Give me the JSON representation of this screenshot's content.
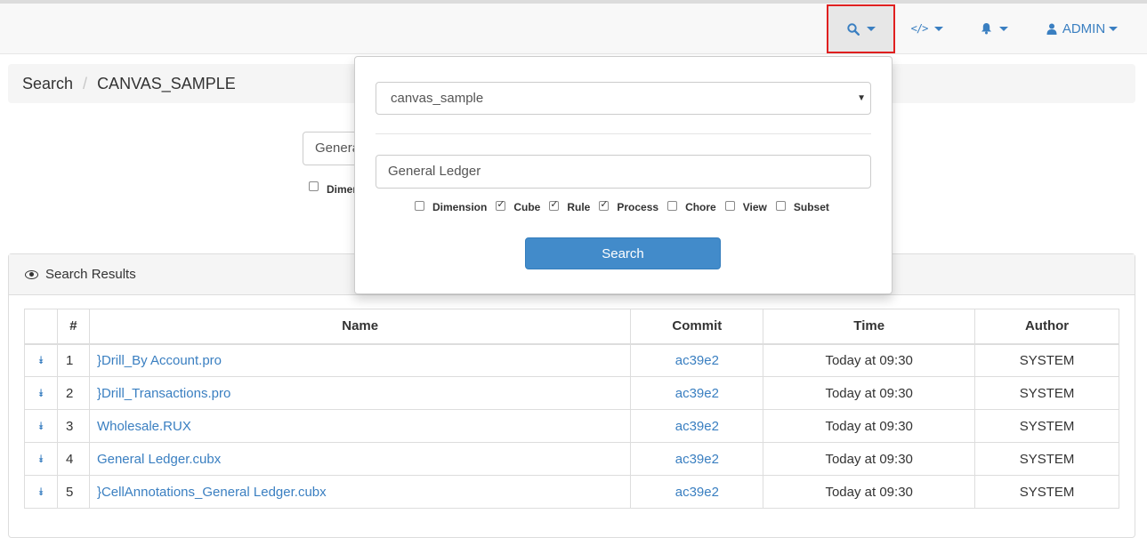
{
  "navbar": {
    "search_icon": "search-icon",
    "code_icon": "code-icon",
    "code_glyph": "</>",
    "bell_icon": "bell-icon",
    "user_icon": "user-icon",
    "admin_label": "ADMIN"
  },
  "breadcrumb": {
    "items": [
      "Search",
      "CANVAS_SAMPLE"
    ],
    "separator": "/"
  },
  "background_form": {
    "search_value_visible": "General Ledger",
    "checkbox_label_visible": "Dimension"
  },
  "dropdown": {
    "instance_select": "canvas_sample",
    "search_value": "General Ledger",
    "filters": [
      {
        "label": "Dimension",
        "checked": false
      },
      {
        "label": "Cube",
        "checked": true
      },
      {
        "label": "Rule",
        "checked": true
      },
      {
        "label": "Process",
        "checked": true
      },
      {
        "label": "Chore",
        "checked": false
      },
      {
        "label": "View",
        "checked": false
      },
      {
        "label": "Subset",
        "checked": false
      }
    ],
    "search_button": "Search"
  },
  "results": {
    "title": "Search Results",
    "columns": [
      "",
      "#",
      "Name",
      "Commit",
      "Time",
      "Author"
    ],
    "rows": [
      {
        "num": "1",
        "name": "}Drill_By Account.pro",
        "commit": "ac39e2",
        "time": "Today at 09:30",
        "author": "SYSTEM"
      },
      {
        "num": "2",
        "name": "}Drill_Transactions.pro",
        "commit": "ac39e2",
        "time": "Today at 09:30",
        "author": "SYSTEM"
      },
      {
        "num": "3",
        "name": "Wholesale.RUX",
        "commit": "ac39e2",
        "time": "Today at 09:30",
        "author": "SYSTEM"
      },
      {
        "num": "4",
        "name": "General Ledger.cubx",
        "commit": "ac39e2",
        "time": "Today at 09:30",
        "author": "SYSTEM"
      },
      {
        "num": "5",
        "name": "}CellAnnotations_General Ledger.cubx",
        "commit": "ac39e2",
        "time": "Today at 09:30",
        "author": "SYSTEM"
      }
    ]
  },
  "colors": {
    "link": "#3a7fc1",
    "primary_button": "#428bca",
    "highlight_border": "#e02020"
  }
}
